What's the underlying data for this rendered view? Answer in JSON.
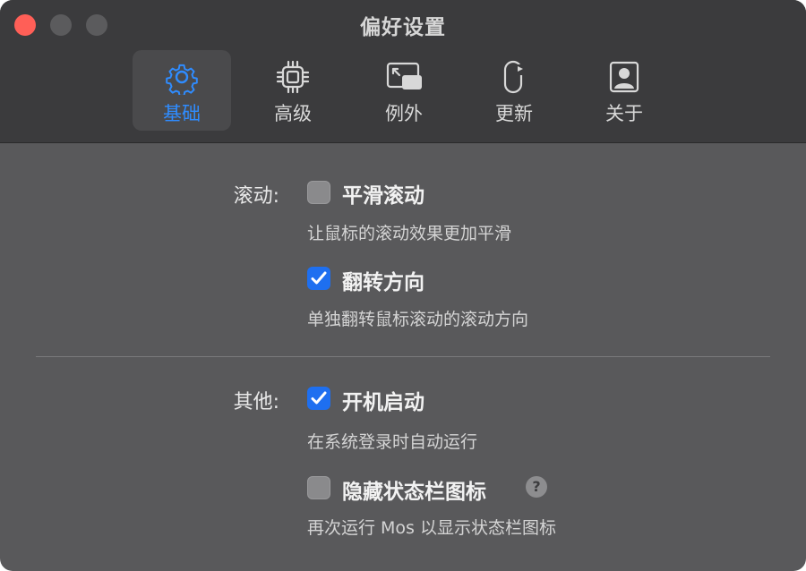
{
  "window": {
    "title": "偏好设置"
  },
  "tabs": [
    {
      "label": "基础",
      "icon": "gear-icon",
      "selected": true
    },
    {
      "label": "高级",
      "icon": "cpu-icon",
      "selected": false
    },
    {
      "label": "例外",
      "icon": "picture-in-picture-icon",
      "selected": false
    },
    {
      "label": "更新",
      "icon": "refresh-icon",
      "selected": false
    },
    {
      "label": "关于",
      "icon": "person-card-icon",
      "selected": false
    }
  ],
  "scroll": {
    "section_label": "滚动:",
    "smooth": {
      "label": "平滑滚动",
      "description": "让鼠标的滚动效果更加平滑",
      "checked": false
    },
    "reverse": {
      "label": "翻转方向",
      "description": "单独翻转鼠标滚动的滚动方向",
      "checked": true
    }
  },
  "other": {
    "section_label": "其他:",
    "launch_at_login": {
      "label": "开机启动",
      "description": "在系统登录时自动运行",
      "checked": true
    },
    "hide_status_bar": {
      "label": "隐藏状态栏图标",
      "description": "再次运行 Mos 以显示状态栏图标",
      "checked": false,
      "help": "?"
    }
  },
  "colors": {
    "accent": "#2f8cff",
    "checkbox_on": "#1e6ff0",
    "close_button": "#ff5f57"
  }
}
